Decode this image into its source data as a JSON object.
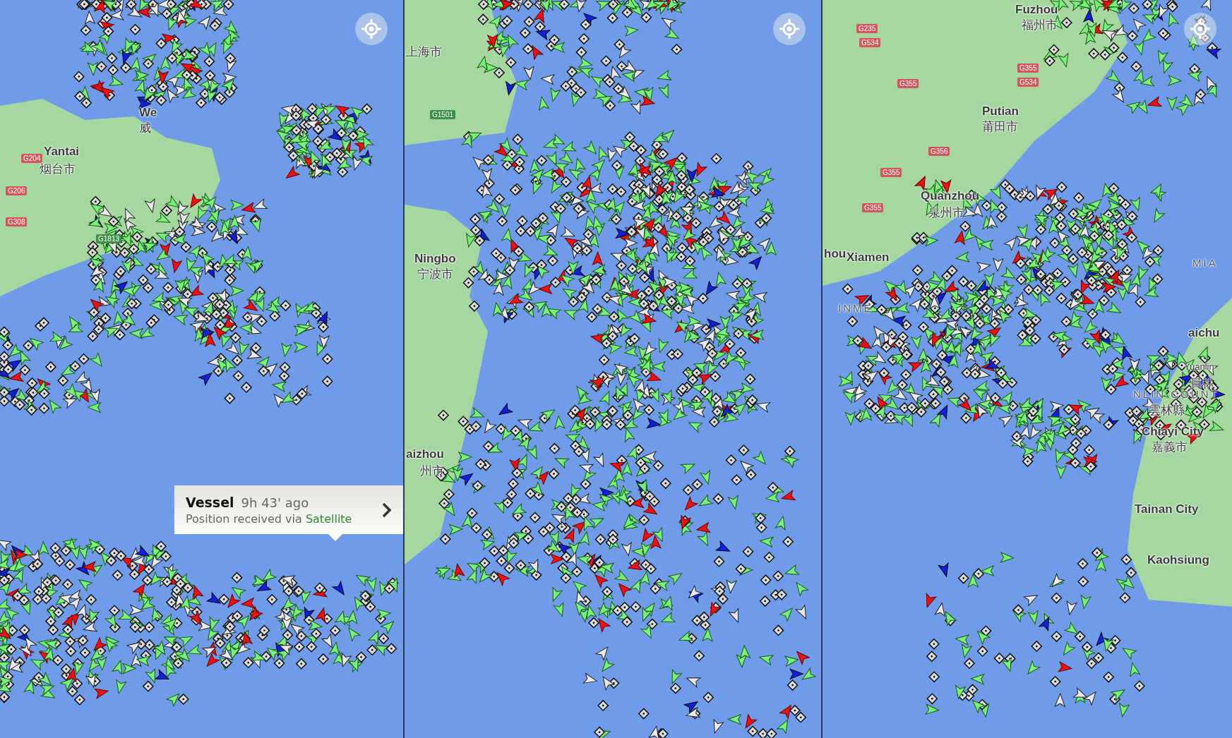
{
  "panels": [
    {
      "labels": [
        {
          "text": "We",
          "kind": "city"
        },
        {
          "text": "威",
          "kind": "city_cn"
        },
        {
          "text": "Yantai",
          "kind": "city"
        },
        {
          "text": "烟台市",
          "kind": "city_cn"
        },
        {
          "text": "G204",
          "kind": "road"
        },
        {
          "text": "G206",
          "kind": "road"
        },
        {
          "text": "G308",
          "kind": "road"
        },
        {
          "text": "G1813",
          "kind": "road_green"
        }
      ]
    },
    {
      "labels": [
        {
          "text": "上海市",
          "kind": "city_cn"
        },
        {
          "text": "G1501",
          "kind": "road_green"
        },
        {
          "text": "Ningbo",
          "kind": "city"
        },
        {
          "text": "宁波市",
          "kind": "city_cn"
        },
        {
          "text": "aizhou",
          "kind": "city"
        },
        {
          "text": "州市",
          "kind": "city_cn"
        }
      ]
    },
    {
      "labels": [
        {
          "text": "Fuzhou",
          "kind": "city"
        },
        {
          "text": "福州市",
          "kind": "city_cn"
        },
        {
          "text": "G235",
          "kind": "road"
        },
        {
          "text": "G534",
          "kind": "road"
        },
        {
          "text": "G355",
          "kind": "road"
        },
        {
          "text": "G534",
          "kind": "road"
        },
        {
          "text": "G355",
          "kind": "road"
        },
        {
          "text": "Putian",
          "kind": "city"
        },
        {
          "text": "莆田市",
          "kind": "city_cn"
        },
        {
          "text": "G356",
          "kind": "road"
        },
        {
          "text": "G355",
          "kind": "road"
        },
        {
          "text": "G355",
          "kind": "road"
        },
        {
          "text": "Quanzhou",
          "kind": "city"
        },
        {
          "text": "泉州市",
          "kind": "city_cn"
        },
        {
          "text": "hou",
          "kind": "city"
        },
        {
          "text": "Xiamen",
          "kind": "city"
        },
        {
          "text": "INME",
          "kind": "region"
        },
        {
          "text": "MIA",
          "kind": "region"
        },
        {
          "text": "aichu",
          "kind": "city"
        },
        {
          "text": "Yuanlin",
          "kind": "town"
        },
        {
          "text": "員林",
          "kind": "city_cn"
        },
        {
          "text": "NLIN COUNT",
          "kind": "region"
        },
        {
          "text": "雲林縣",
          "kind": "city_cn"
        },
        {
          "text": "Chiayi City",
          "kind": "city"
        },
        {
          "text": "嘉義市",
          "kind": "city_cn"
        },
        {
          "text": "Tainan City",
          "kind": "city"
        },
        {
          "text": "Kaohsiung",
          "kind": "city"
        }
      ]
    }
  ],
  "tooltip": {
    "title": "Vessel",
    "age": "9h 43' ago",
    "text": "Position received via",
    "source": "Satellite"
  }
}
